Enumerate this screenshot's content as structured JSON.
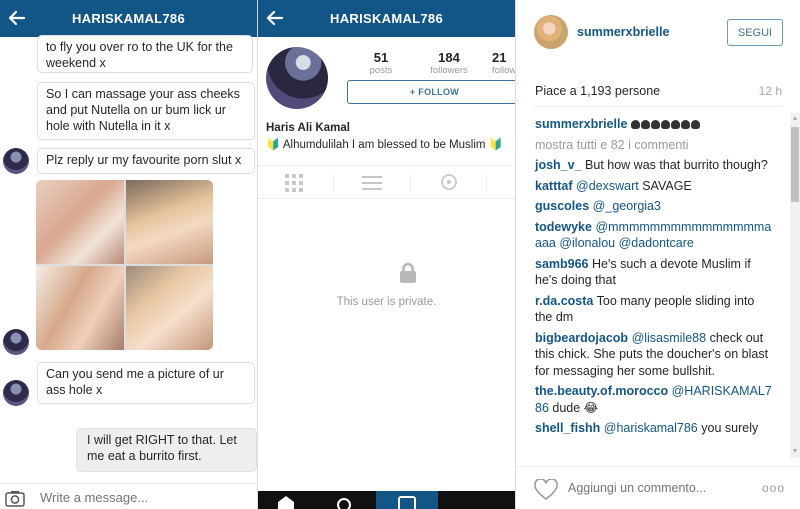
{
  "dm": {
    "title": "HARISKAMAL786",
    "messages": [
      "to fly you over ro to the UK for the weekend x",
      "So I can massage your ass cheeks and put Nutella on ur bum lick ur hole with Nutella in it x",
      "Plz reply ur my favourite porn slut x",
      "Can you send me a picture of ur ass hole x"
    ],
    "reply": "I will get RIGHT to that. Let me eat a burrito first.",
    "compose_placeholder": "Write a message..."
  },
  "profile": {
    "title": "HARISKAMAL786",
    "stats": [
      {
        "value": "51",
        "label": "posts"
      },
      {
        "value": "184",
        "label": "followers"
      },
      {
        "value": "21",
        "label": "following"
      }
    ],
    "follow_label": "+ FOLLOW",
    "name": "Haris Ali Kamal",
    "bio": "🔰 Alhumdulilah I am blessed to be Muslim 🔰",
    "private_text": "This user is private."
  },
  "web": {
    "username": "summerxbrielle",
    "segui_label": "SEGUI",
    "likes": "Piace a 1,193 persone",
    "time": "12 h",
    "caption_user": "summerxbrielle",
    "show_all": "mostra tutti e 82 i commenti",
    "comments": [
      {
        "user": "josh_v_",
        "mention": "",
        "text": "But how was that burrito though?"
      },
      {
        "user": "katttaf",
        "mention": "@dexswart",
        "text": "SAVAGE"
      },
      {
        "user": "guscoles",
        "mention": "@_georgia3",
        "text": ""
      },
      {
        "user": "todewyke",
        "mention": "@mmmmmmmmmmmmmmmaaaa @ilonalou @dadontcare",
        "text": ""
      },
      {
        "user": "samb966",
        "mention": "",
        "text": "He's such a devote Muslim if he's doing that"
      },
      {
        "user": "r.da.costa",
        "mention": "",
        "text": "Too many people sliding into the dm"
      },
      {
        "user": "bigbeardojacob",
        "mention": "@lisasmile88",
        "text": "check out this chick. She puts the doucher's on blast for messaging her some bullshit."
      },
      {
        "user": "the.beauty.of.morocco",
        "mention": "@HARISKAMAL786",
        "text": "dude 😂"
      },
      {
        "user": "shell_fishh",
        "mention": "@hariskamal786",
        "text": "you surely"
      }
    ],
    "comment_placeholder": "Aggiungi un commento...",
    "more_label": "ooo"
  },
  "colors": {
    "brand_blue": "#125688",
    "link_blue": "#125688"
  }
}
